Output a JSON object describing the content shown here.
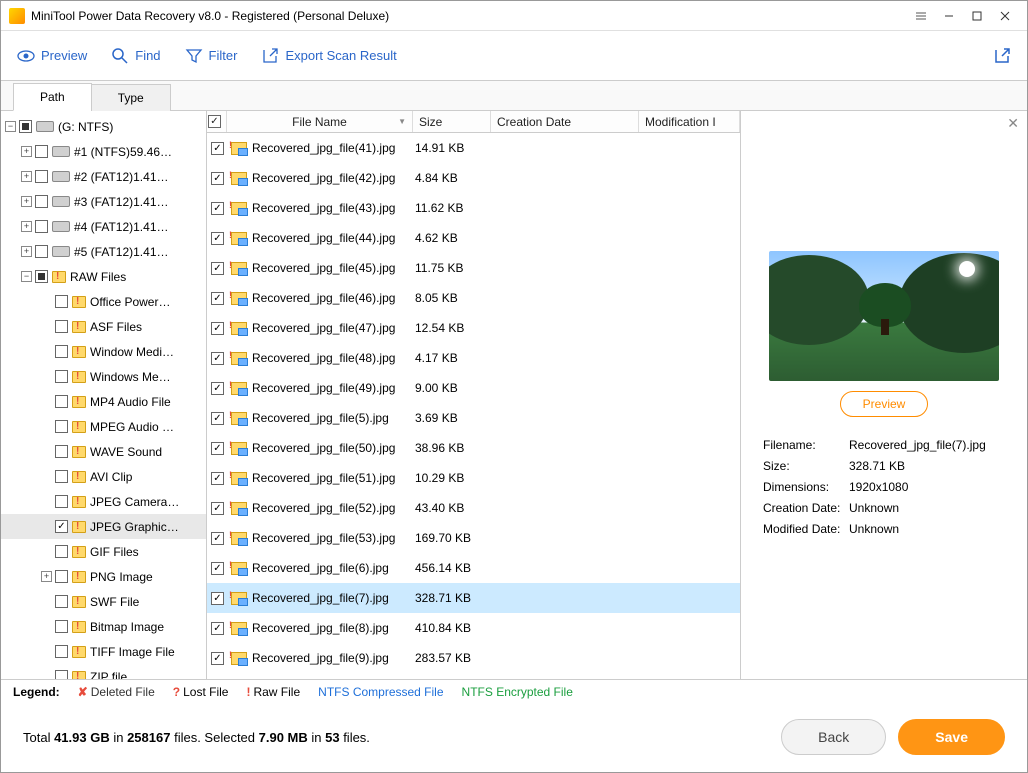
{
  "title": "MiniTool Power Data Recovery v8.0 - Registered (Personal Deluxe)",
  "toolbar": {
    "preview": "Preview",
    "find": "Find",
    "filter": "Filter",
    "export": "Export Scan Result"
  },
  "tabs": {
    "path": "Path",
    "type": "Type"
  },
  "tree": {
    "root": "(G: NTFS)",
    "partitions": [
      "#1 (NTFS)59.46…",
      "#2 (FAT12)1.41…",
      "#3 (FAT12)1.41…",
      "#4 (FAT12)1.41…",
      "#5 (FAT12)1.41…"
    ],
    "raw_label": "RAW Files",
    "raw_children": [
      {
        "label": "Office Power…",
        "checked": false
      },
      {
        "label": "ASF Files",
        "checked": false
      },
      {
        "label": "Window Medi…",
        "checked": false
      },
      {
        "label": "Windows Me…",
        "checked": false
      },
      {
        "label": "MP4 Audio File",
        "checked": false
      },
      {
        "label": "MPEG Audio …",
        "checked": false
      },
      {
        "label": "WAVE Sound",
        "checked": false
      },
      {
        "label": "AVI Clip",
        "checked": false
      },
      {
        "label": "JPEG Camera…",
        "checked": false
      },
      {
        "label": "JPEG Graphic…",
        "checked": true,
        "selected": true
      },
      {
        "label": "GIF Files",
        "checked": false
      },
      {
        "label": "PNG Image",
        "checked": false,
        "expandable": true
      },
      {
        "label": "SWF File",
        "checked": false
      },
      {
        "label": "Bitmap Image",
        "checked": false
      },
      {
        "label": "TIFF Image File",
        "checked": false
      },
      {
        "label": "ZIP file",
        "checked": false
      }
    ]
  },
  "columns": {
    "name": "File Name",
    "size": "Size",
    "cd": "Creation Date",
    "md": "Modification I"
  },
  "files": [
    {
      "name": "Recovered_jpg_file(41).jpg",
      "size": "14.91 KB"
    },
    {
      "name": "Recovered_jpg_file(42).jpg",
      "size": "4.84 KB"
    },
    {
      "name": "Recovered_jpg_file(43).jpg",
      "size": "11.62 KB"
    },
    {
      "name": "Recovered_jpg_file(44).jpg",
      "size": "4.62 KB"
    },
    {
      "name": "Recovered_jpg_file(45).jpg",
      "size": "11.75 KB"
    },
    {
      "name": "Recovered_jpg_file(46).jpg",
      "size": "8.05 KB"
    },
    {
      "name": "Recovered_jpg_file(47).jpg",
      "size": "12.54 KB"
    },
    {
      "name": "Recovered_jpg_file(48).jpg",
      "size": "4.17 KB"
    },
    {
      "name": "Recovered_jpg_file(49).jpg",
      "size": "9.00 KB"
    },
    {
      "name": "Recovered_jpg_file(5).jpg",
      "size": "3.69 KB"
    },
    {
      "name": "Recovered_jpg_file(50).jpg",
      "size": "38.96 KB"
    },
    {
      "name": "Recovered_jpg_file(51).jpg",
      "size": "10.29 KB"
    },
    {
      "name": "Recovered_jpg_file(52).jpg",
      "size": "43.40 KB"
    },
    {
      "name": "Recovered_jpg_file(53).jpg",
      "size": "169.70 KB"
    },
    {
      "name": "Recovered_jpg_file(6).jpg",
      "size": "456.14 KB"
    },
    {
      "name": "Recovered_jpg_file(7).jpg",
      "size": "328.71 KB",
      "selected": true
    },
    {
      "name": "Recovered_jpg_file(8).jpg",
      "size": "410.84 KB"
    },
    {
      "name": "Recovered_jpg_file(9).jpg",
      "size": "283.57 KB"
    }
  ],
  "preview": {
    "button": "Preview",
    "labels": {
      "filename": "Filename:",
      "size": "Size:",
      "dimensions": "Dimensions:",
      "cd": "Creation Date:",
      "md": "Modified Date:"
    },
    "values": {
      "filename": "Recovered_jpg_file(7).jpg",
      "size": "328.71 KB",
      "dimensions": "1920x1080",
      "cd": "Unknown",
      "md": "Unknown"
    }
  },
  "legend": {
    "label": "Legend:",
    "deleted": "Deleted File",
    "lost": "Lost File",
    "raw": "Raw File",
    "compressed": "NTFS Compressed File",
    "encrypted": "NTFS Encrypted File"
  },
  "footer": {
    "total_label": "Total ",
    "total_size": "41.93 GB",
    "in1": " in ",
    "total_files": "258167",
    "files1": " files.  Selected ",
    "sel_size": "7.90 MB",
    "in2": " in ",
    "sel_files": "53",
    "files2": " files.",
    "back": "Back",
    "save": "Save"
  }
}
